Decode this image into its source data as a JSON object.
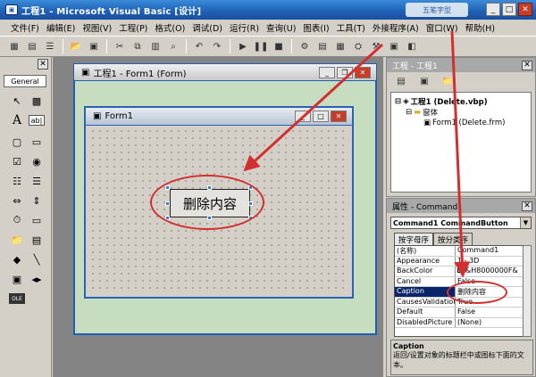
{
  "window": {
    "title": "工程1 - Microsoft Visual Basic [设计]",
    "watermark": "五笔字型"
  },
  "menu": [
    "文件(F)",
    "编辑(E)",
    "视图(V)",
    "工程(P)",
    "格式(O)",
    "调试(D)",
    "运行(R)",
    "查询(U)",
    "图表(I)",
    "工具(T)",
    "外接程序(A)",
    "窗口(W)",
    "帮助(H)"
  ],
  "toolbox": {
    "title": "General"
  },
  "designer": {
    "title": "工程1 - Form1 (Form)",
    "form_title": "Form1",
    "button_caption": "删除内容"
  },
  "project": {
    "title": "工程 - 工程1",
    "tree": [
      "工程1 (Delete.vbp)",
      "窗体",
      "Form1 (Delete.frm)"
    ]
  },
  "properties": {
    "title": "属性 - Command",
    "object": "Command1 CommandButton",
    "tabs": [
      "按字母序",
      "按分类序"
    ],
    "rows": [
      {
        "name": "(名称)",
        "value": "Command1"
      },
      {
        "name": "Appearance",
        "value": "1 - 3D"
      },
      {
        "name": "BackColor",
        "value": "&H8000000F&"
      },
      {
        "name": "Cancel",
        "value": "False"
      },
      {
        "name": "Caption",
        "value": "删除内容"
      },
      {
        "name": "CausesValidation",
        "value": "True"
      },
      {
        "name": "Default",
        "value": "False"
      },
      {
        "name": "DisabledPicture",
        "value": "(None)"
      }
    ],
    "desc_title": "Caption",
    "desc_text": "返回/设置对象的标题栏中或图标下面的文本。"
  },
  "colors": {
    "annotation_red": "#d23030",
    "titlebar_blue": "#1d5fb5"
  }
}
